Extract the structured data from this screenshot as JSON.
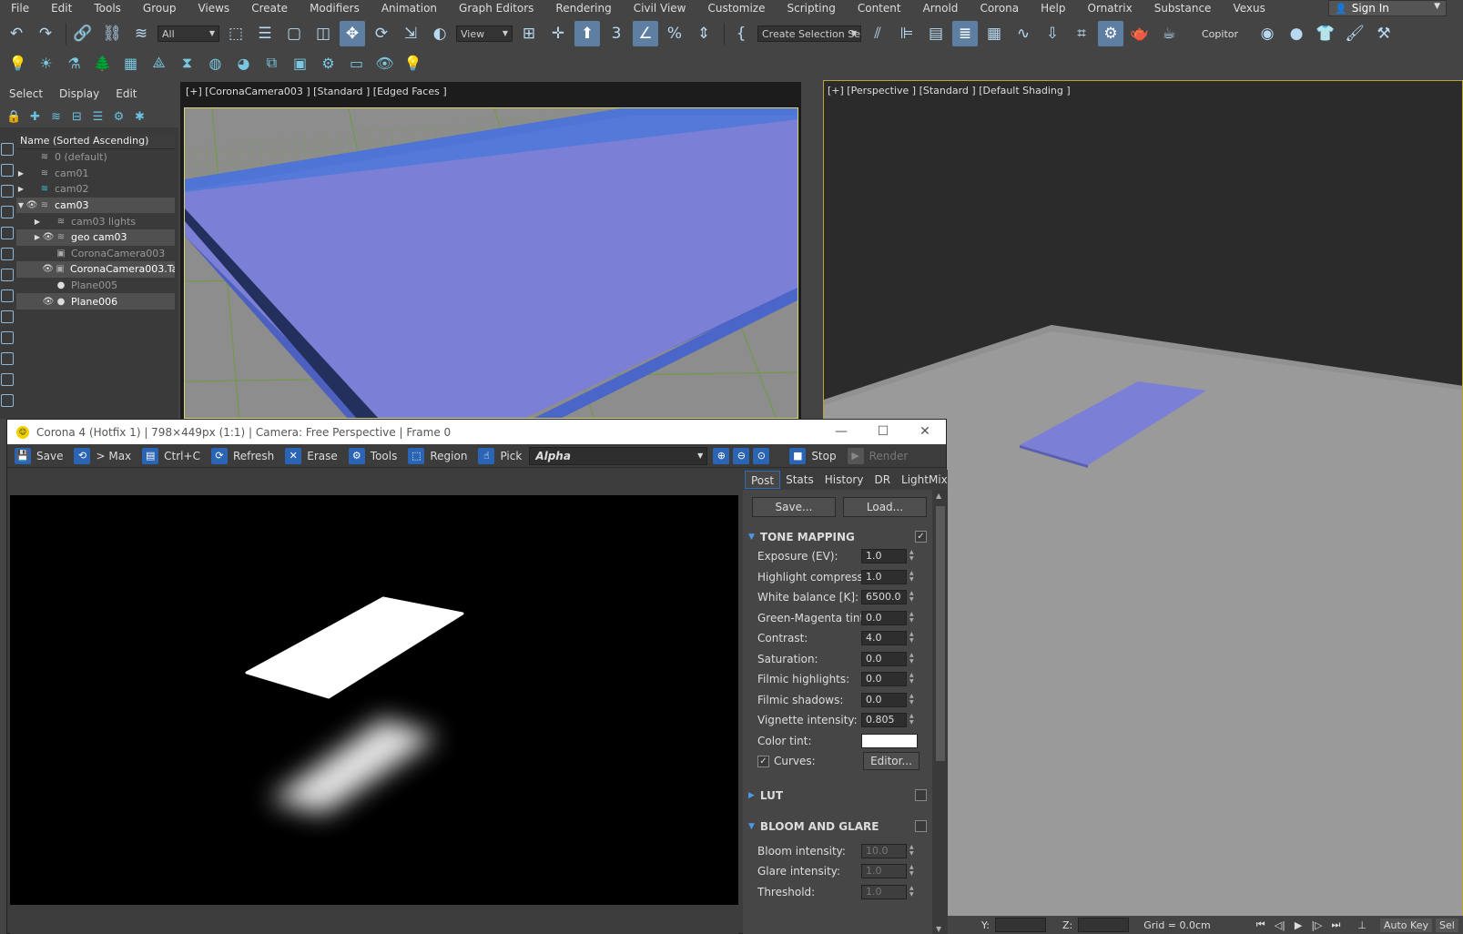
{
  "menubar": {
    "items": [
      "File",
      "Edit",
      "Tools",
      "Group",
      "Views",
      "Create",
      "Modifiers",
      "Animation",
      "Graph Editors",
      "Rendering",
      "Civil View",
      "Customize",
      "Scripting",
      "Content",
      "Arnold",
      "Corona",
      "Help",
      "Ornatrix",
      "Substance",
      "Vexus"
    ],
    "sign_in": "Sign In"
  },
  "toolbar": {
    "selection_filter": "All",
    "ref_coord": "View",
    "named_selection": "Create Selection Se",
    "copitor_label": "Copitor"
  },
  "explorer": {
    "menu": [
      "Select",
      "Display",
      "Edit"
    ],
    "column_header": "Name (Sorted Ascending)",
    "rows": [
      {
        "label": "0 (default)",
        "indent": 0,
        "expander": "",
        "eye": false,
        "type": "layer",
        "dim": true
      },
      {
        "label": "cam01",
        "indent": 0,
        "expander": "▶",
        "eye": false,
        "type": "layer",
        "dim": true
      },
      {
        "label": "cam02",
        "indent": 0,
        "expander": "▶",
        "eye": false,
        "type": "layer-active",
        "dim": true
      },
      {
        "label": "cam03",
        "indent": 0,
        "expander": "▼",
        "eye": true,
        "type": "layer",
        "dim": false
      },
      {
        "label": "cam03 lights",
        "indent": 1,
        "expander": "▶",
        "eye": false,
        "type": "layer",
        "dim": true
      },
      {
        "label": "geo cam03",
        "indent": 1,
        "expander": "▶",
        "eye": true,
        "type": "layer",
        "dim": false
      },
      {
        "label": "CoronaCamera003",
        "indent": 1,
        "expander": "",
        "eye": false,
        "type": "camera",
        "dim": true
      },
      {
        "label": "CoronaCamera003.Ta",
        "indent": 1,
        "expander": "",
        "eye": true,
        "type": "camera",
        "dim": false
      },
      {
        "label": "Plane005",
        "indent": 1,
        "expander": "",
        "eye": false,
        "type": "object",
        "dim": true
      },
      {
        "label": "Plane006",
        "indent": 1,
        "expander": "",
        "eye": true,
        "type": "object",
        "dim": false
      }
    ]
  },
  "viewport_left": {
    "label": "[+] [CoronaCamera003 ] [Standard ] [Edged Faces ]"
  },
  "viewport_right": {
    "label": "[+] [Perspective ] [Standard ] [Default Shading ]"
  },
  "statusbar": {
    "y_label": "Y:",
    "z_label": "Z:",
    "grid": "Grid = 0.0cm",
    "auto_key": "Auto Key",
    "sel": "Sel"
  },
  "vfb": {
    "title": "Corona 4 (Hotfix 1) | 798×449px (1:1) | Camera: Free Perspective | Frame 0",
    "buttons": {
      "save": "Save",
      "to_max": "> Max",
      "copy": "Ctrl+C",
      "refresh": "Refresh",
      "erase": "Erase",
      "tools": "Tools",
      "region": "Region",
      "pick": "Pick",
      "stop": "Stop",
      "render": "Render"
    },
    "channel": "Alpha",
    "tabs": [
      "Post",
      "Stats",
      "History",
      "DR",
      "LightMix"
    ],
    "active_tab": "Post",
    "post": {
      "save": "Save...",
      "load": "Load...",
      "tone_mapping": {
        "title": "TONE MAPPING",
        "enabled": true,
        "params": [
          {
            "label": "Exposure (EV):",
            "value": "1.0"
          },
          {
            "label": "Highlight compress:",
            "value": "1.0"
          },
          {
            "label": "White balance [K]:",
            "value": "6500.0"
          },
          {
            "label": "Green-Magenta tint:",
            "value": "0.0"
          },
          {
            "label": "Contrast:",
            "value": "4.0"
          },
          {
            "label": "Saturation:",
            "value": "0.0"
          },
          {
            "label": "Filmic highlights:",
            "value": "0.0"
          },
          {
            "label": "Filmic shadows:",
            "value": "0.0"
          },
          {
            "label": "Vignette intensity:",
            "value": "0.805"
          }
        ],
        "color_tint_label": "Color tint:",
        "color_tint": "#ffffff",
        "curves_label": "Curves:",
        "curves_enabled": true,
        "editor": "Editor..."
      },
      "lut": {
        "title": "LUT",
        "enabled": false
      },
      "bloom": {
        "title": "BLOOM AND GLARE",
        "enabled": false,
        "params": [
          {
            "label": "Bloom intensity:",
            "value": "10.0"
          },
          {
            "label": "Glare intensity:",
            "value": "1.0"
          },
          {
            "label": "Threshold:",
            "value": "1.0"
          }
        ]
      }
    }
  },
  "colors": {
    "accent": "#2a64b4",
    "plane": "#7b7fd6",
    "viewport_border": "#d3d37a"
  }
}
